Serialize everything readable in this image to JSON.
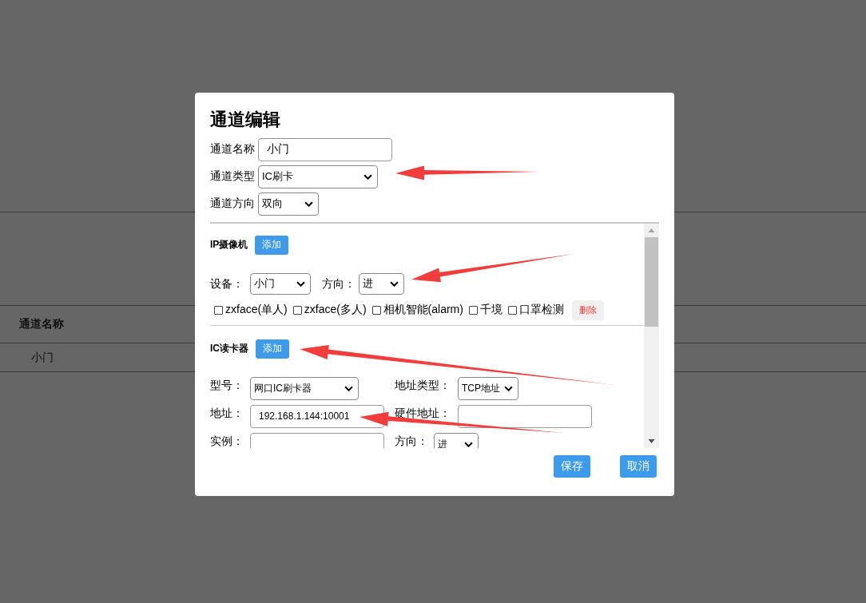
{
  "background_table": {
    "columns": [
      "通道名称"
    ],
    "rows": [
      [
        "小门"
      ]
    ]
  },
  "dialog": {
    "title": "通道编辑",
    "fields": [
      {
        "label": "通道名称",
        "kind": "input",
        "value": "小门"
      },
      {
        "label": "通道类型",
        "kind": "select",
        "value": "IC刷卡"
      },
      {
        "label": "通道方向",
        "kind": "select",
        "value": "双向"
      }
    ],
    "camera_section": {
      "title": "IP摄像机",
      "add_button": "添加",
      "fields": [
        {
          "label": "设备：",
          "kind": "select",
          "value": "小门"
        },
        {
          "label": "方向：",
          "kind": "select",
          "value": "进"
        }
      ],
      "options": [
        {
          "label": "zxface(单人)",
          "checked": false
        },
        {
          "label": "zxface(多人)",
          "checked": false
        },
        {
          "label": "相机智能(alarm)",
          "checked": false
        },
        {
          "label": "千境",
          "checked": false
        },
        {
          "label": "口罩检测",
          "checked": false
        }
      ],
      "delete_button": "删除"
    },
    "reader_section": {
      "title": "IC读卡器",
      "add_button": "添加",
      "fields": [
        {
          "label": "型号：",
          "kind": "select",
          "value": "网口IC刷卡器"
        },
        {
          "label": "地址类型：",
          "kind": "select",
          "value": "TCP地址"
        },
        {
          "label": "地址：",
          "kind": "input",
          "value": "192.168.1.144:10001"
        },
        {
          "label": "硬件地址：",
          "kind": "input"
        },
        {
          "label": "实例：",
          "kind": "input"
        },
        {
          "label": "方向：",
          "kind": "select",
          "value": "进"
        }
      ]
    },
    "buttons": [
      "保存",
      "取消"
    ]
  }
}
